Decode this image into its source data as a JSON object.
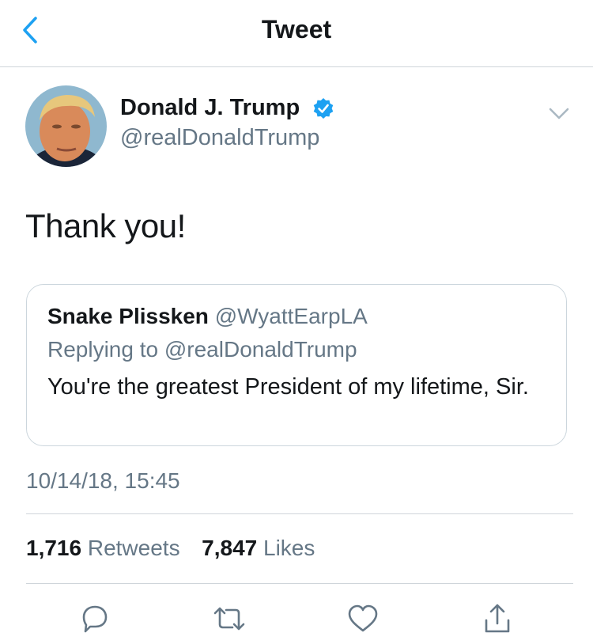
{
  "header": {
    "title": "Tweet",
    "back_icon": "chevron-left-icon"
  },
  "tweet": {
    "author_name": "Donald J. Trump",
    "author_handle": "@realDonaldTrump",
    "verified": true,
    "text": "Thank you!",
    "timestamp": "10/14/18, 15:45"
  },
  "quote": {
    "author_name": "Snake Plissken",
    "author_handle": "@WyattEarpLA",
    "replying_to": "Replying to @realDonaldTrump",
    "text": "You're the greatest President of my lifetime, Sir."
  },
  "stats": {
    "retweets_count": "1,716",
    "retweets_label": "Retweets",
    "likes_count": "7,847",
    "likes_label": "Likes"
  },
  "actions": [
    "reply-icon",
    "retweet-icon",
    "like-icon",
    "share-icon"
  ],
  "colors": {
    "accent": "#1da1f2",
    "secondary_text": "#657786",
    "icon": "#657786",
    "divider": "#cfd5da"
  }
}
